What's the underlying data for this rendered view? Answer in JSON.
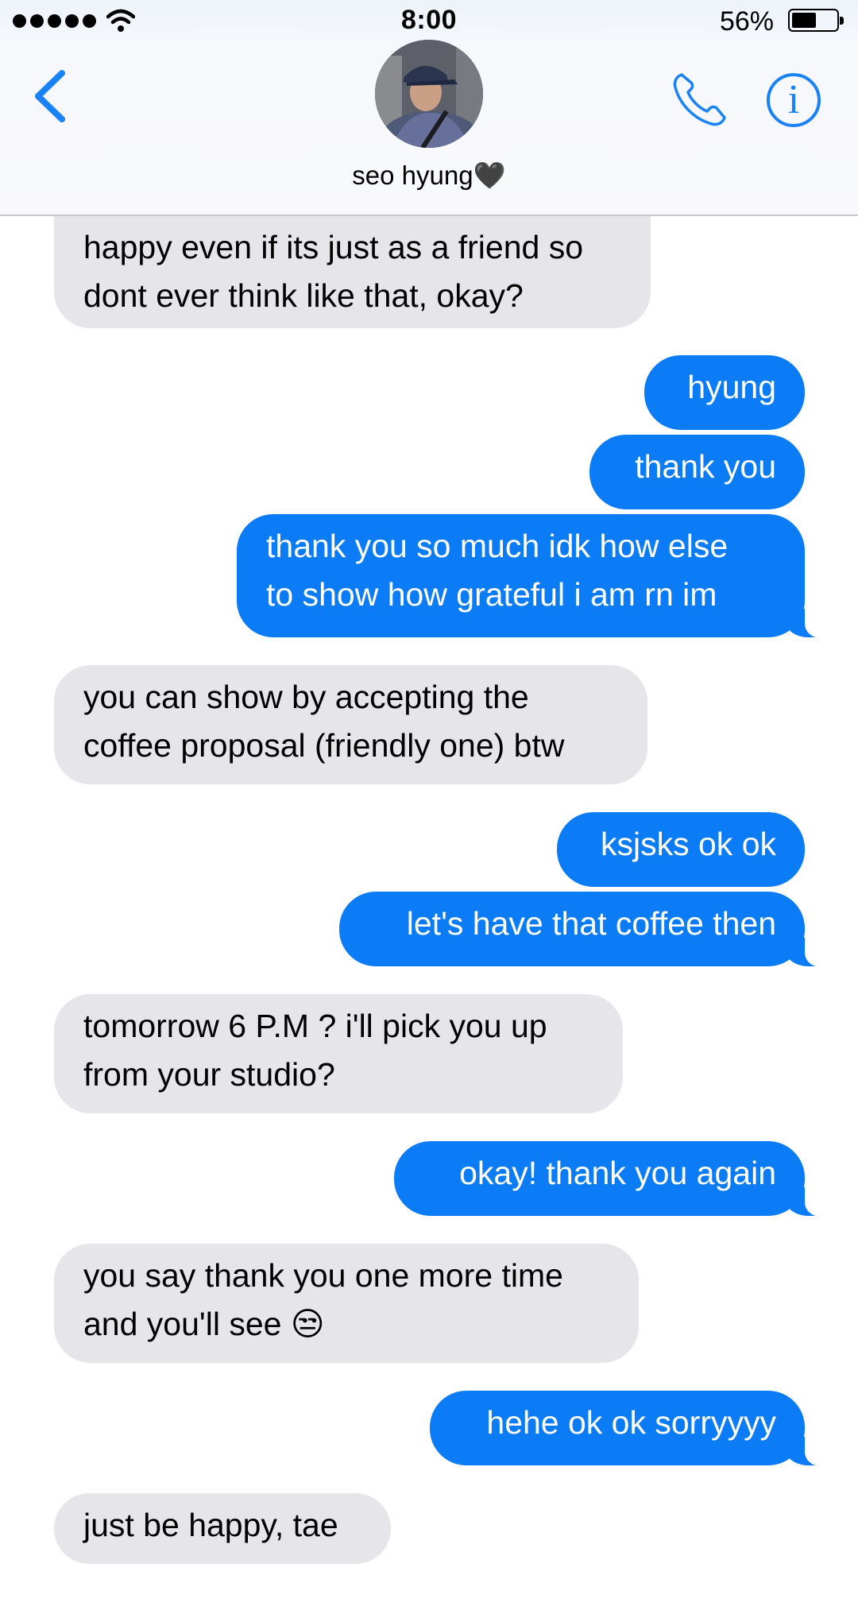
{
  "status_bar": {
    "time": "8:00",
    "battery_percent": "56%",
    "battery_level": 0.56
  },
  "header": {
    "contact_name": "seo hyung🖤",
    "back_icon": "chevron-left-icon",
    "call_icon": "phone-icon",
    "info_icon": "info-icon",
    "info_glyph": "i",
    "accent_color": "#1a82f7"
  },
  "messages": [
    {
      "direction": "incoming",
      "lines": [
        "happy even if its just as a friend so",
        "dont ever think like that, okay?"
      ]
    },
    {
      "direction": "outgoing",
      "lines": [
        "hyung"
      ]
    },
    {
      "direction": "outgoing",
      "lines": [
        "thank you"
      ]
    },
    {
      "direction": "outgoing",
      "lines": [
        "thank you so much idk how else",
        "to show how grateful i am rn im"
      ]
    },
    {
      "direction": "incoming",
      "lines": [
        "you can show by accepting the",
        "coffee proposal (friendly one) btw"
      ]
    },
    {
      "direction": "outgoing",
      "lines": [
        "ksjsks ok ok"
      ]
    },
    {
      "direction": "outgoing",
      "lines": [
        "let's have that coffee then"
      ]
    },
    {
      "direction": "incoming",
      "lines": [
        "tomorrow 6 P.M ? i'll pick you up",
        "from your studio?"
      ]
    },
    {
      "direction": "outgoing",
      "lines": [
        "okay! thank you again"
      ]
    },
    {
      "direction": "incoming",
      "lines": [
        "you say thank you one more time",
        "and you'll see 😒"
      ]
    },
    {
      "direction": "outgoing",
      "lines": [
        "hehe ok ok sorryyyy"
      ]
    },
    {
      "direction": "incoming",
      "lines": [
        "just be happy, tae"
      ]
    }
  ],
  "colors": {
    "incoming_bubble": "#e5e5ea",
    "outgoing_bubble": "#0b7cf6"
  }
}
